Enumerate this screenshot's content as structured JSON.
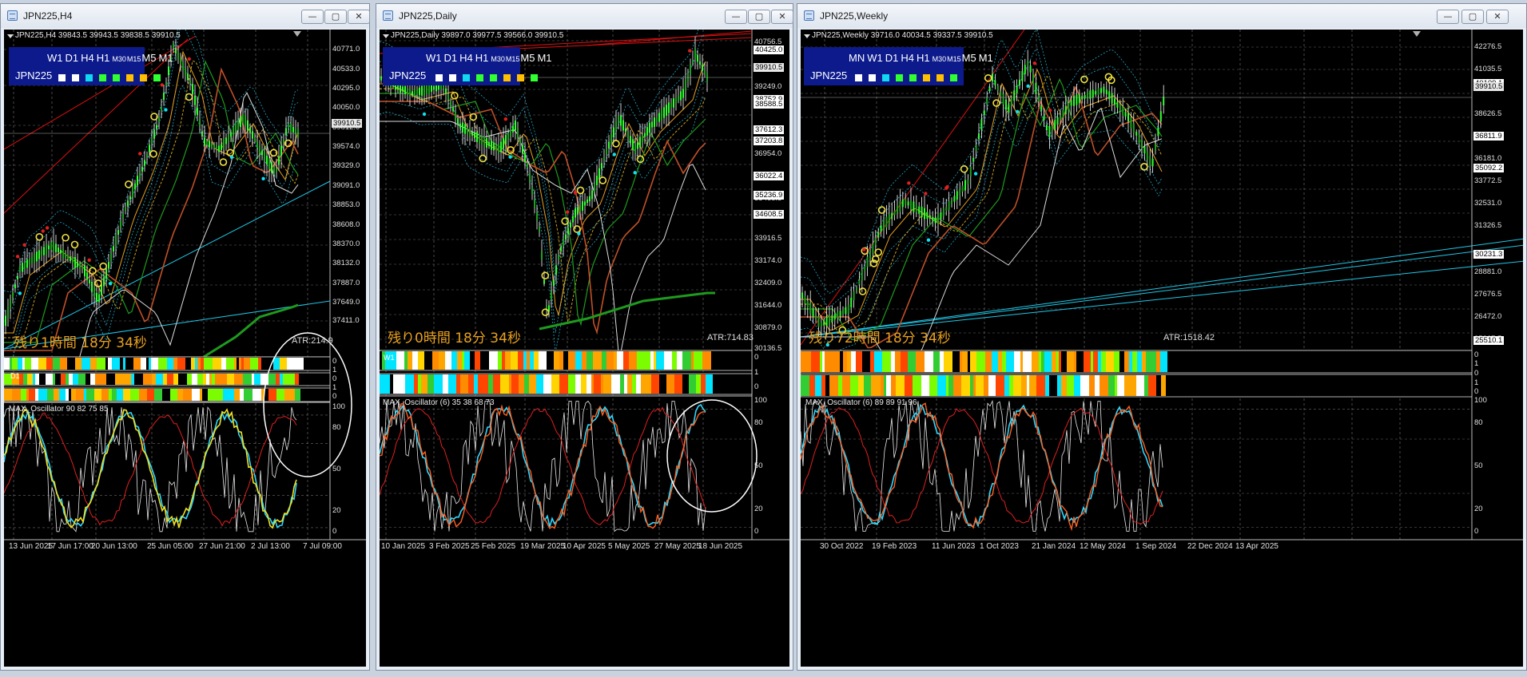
{
  "colors": {
    "candle_up": "#33ff33",
    "candle_wick": "#ffffff",
    "trend_red": "#e01010",
    "trend_cyan": "#20c8e8",
    "ma_orange": "#e8a020",
    "ma_brown": "#c05028",
    "ma_green": "#1e9a1e",
    "timer_text": "#e8a020",
    "panel_blue": "#0c1a8c"
  },
  "timeframe_squares": [
    "#ffffff",
    "#ffffff",
    "#10d8f0",
    "#30ff30",
    "#30ff30",
    "#ffc000",
    "#ffc000",
    "#30ff30"
  ],
  "windows": [
    {
      "id": "h4",
      "title": "JPN225,H4",
      "icon": "chart-window-icon",
      "symbol_line": "JPN225,H4   39843.5  39943.5  39838.5  39910.5",
      "tf_panel": {
        "labels": [
          "W1",
          "D1",
          "H4",
          "H1",
          "M30",
          "M15",
          "M5",
          "M1"
        ],
        "symbol": "JPN225"
      },
      "timer_text": "残り1時間 18分 34秒",
      "atr_text": "ATR:214.9",
      "osc_label": "MAX_Oscillator 90 82 75 85",
      "bar_rows": [
        "",
        "D1",
        ""
      ],
      "price_scale": [
        "40771.0",
        "40533.0",
        "40295.0",
        "40050.0",
        "39812.0",
        "39574.0",
        "39329.0",
        "39091.0",
        "38853.0",
        "38608.0",
        "38370.0",
        "38132.0",
        "37887.0",
        "37649.0",
        "37411.0"
      ],
      "price_tags": [
        {
          "text": "39910.5",
          "type": "current"
        }
      ],
      "osc_scale": [
        "100",
        "80",
        "50",
        "20",
        "0"
      ],
      "bar_scale": [
        "0",
        "1",
        "0",
        "1",
        "0"
      ],
      "dates": [
        "13 Jun 2025",
        "17 Jun 17:00",
        "20 Jun 13:00",
        "25 Jun 05:00",
        "27 Jun 21:00",
        "2 Jul 13:00",
        "7 Jul 09:00"
      ],
      "buttons": {
        "min": "—",
        "max": "▢",
        "close": "✕"
      }
    },
    {
      "id": "daily",
      "title": "JPN225,Daily",
      "icon": "chart-window-icon",
      "symbol_line": "JPN225,Daily   39897.0  39977.5  39566.0  39910.5",
      "tf_panel": {
        "labels": [
          "W1",
          "D1",
          "H4",
          "H1",
          "M30",
          "M15",
          "M5",
          "M1"
        ],
        "symbol": "JPN225"
      },
      "timer_text": "残り0時間 18分 34秒",
      "atr_text": "ATR:714.83",
      "osc_label": "MAX_Oscillator (6) 35 38 68 73",
      "bar_rows": [
        "W1",
        "",
        ""
      ],
      "price_scale": [
        "40756.5",
        "39249.0",
        "36954.0",
        "36211.5",
        "35468.5",
        "33916.5",
        "33174.0",
        "32409.0",
        "31644.0",
        "30879.0",
        "30136.5"
      ],
      "price_tags": [
        {
          "text": "40425.0",
          "type": "white"
        },
        {
          "text": "39910.5",
          "type": "current"
        },
        {
          "text": "38752.9",
          "type": "white"
        },
        {
          "text": "38588.5",
          "type": "white"
        },
        {
          "text": "37612.3",
          "type": "white"
        },
        {
          "text": "37203.8",
          "type": "white"
        },
        {
          "text": "36022.4",
          "type": "white"
        },
        {
          "text": "35236.9",
          "type": "white"
        },
        {
          "text": "34608.5",
          "type": "white"
        }
      ],
      "osc_scale": [
        "100",
        "80",
        "50",
        "20",
        "0"
      ],
      "bar_scale": [
        "0",
        "1",
        "0"
      ],
      "dates": [
        "10 Jan 2025",
        "3 Feb 2025",
        "25 Feb 2025",
        "19 Mar 2025",
        "10 Apr 2025",
        "5 May 2025",
        "27 May 2025",
        "18 Jun 2025"
      ],
      "buttons": {
        "min": "—",
        "max": "▢",
        "close": "✕"
      }
    },
    {
      "id": "weekly",
      "title": "JPN225,Weekly",
      "icon": "chart-window-icon",
      "symbol_line": "JPN225,Weekly   39716.0  40034.5  39337.5  39910.5",
      "tf_panel": {
        "labels": [
          "MN",
          "W1",
          "D1",
          "H4",
          "H1",
          "M30",
          "M15",
          "M5",
          "M1"
        ],
        "symbol": "JPN225"
      },
      "timer_text": "残り72時間 18分 34秒",
      "atr_text": "ATR:1518.42",
      "osc_label": "MAX_Oscillator (6) 89 89 91 96",
      "bar_rows": [
        "",
        "",
        ""
      ],
      "price_scale": [
        "42276.5",
        "41035.5",
        "38626.5",
        "37422.0",
        "36181.0",
        "33772.5",
        "32531.0",
        "31326.5",
        "28881.0",
        "27676.5",
        "26472.0",
        "25267.5"
      ],
      "price_tags": [
        {
          "text": "40109.1",
          "type": "white"
        },
        {
          "text": "39910.5",
          "type": "current"
        },
        {
          "text": "36811.9",
          "type": "white"
        },
        {
          "text": "35092.2",
          "type": "white"
        },
        {
          "text": "30231.3",
          "type": "white"
        },
        {
          "text": "25510.1",
          "type": "white"
        }
      ],
      "osc_scale": [
        "100",
        "80",
        "50",
        "20",
        "0"
      ],
      "bar_scale": [
        "0",
        "1",
        "0",
        "1",
        "0"
      ],
      "dates": [
        "30 Oct 2022",
        "19 Feb 2023",
        "11 Jun 2023",
        "1 Oct 2023",
        "21 Jan 2024",
        "12 May 2024",
        "1 Sep 2024",
        "22 Dec 2024",
        "13 Apr 2025"
      ],
      "buttons": {
        "min": "—",
        "max": "▢",
        "close": "✕"
      }
    }
  ]
}
